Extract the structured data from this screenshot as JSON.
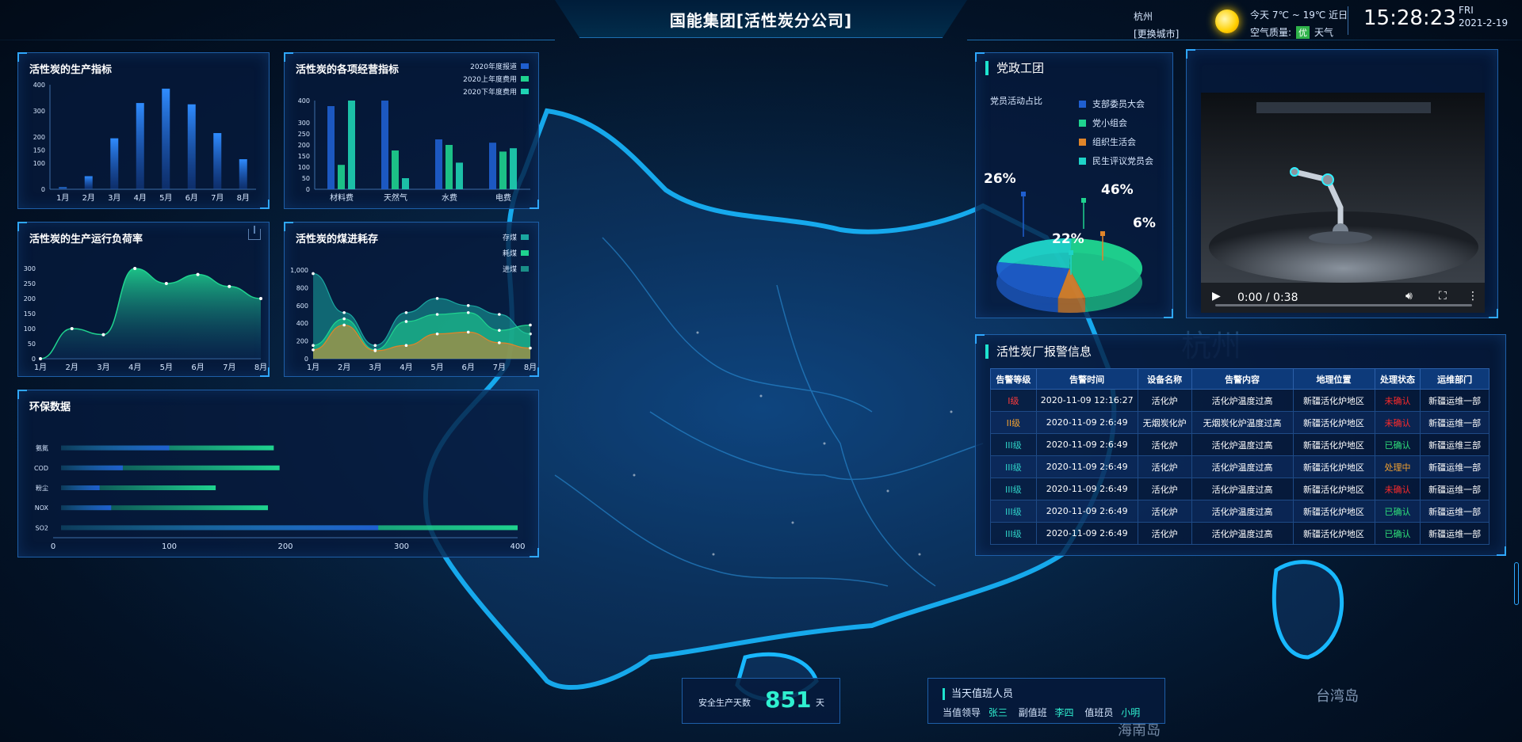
{
  "header": {
    "title": "国能集团[活性炭分公司]",
    "city": "杭州",
    "change_city": "[更换城市]",
    "weather_today": "今天  7℃ ~ 19℃ 近日",
    "air_quality_label": "空气质量:",
    "air_quality_value": "优",
    "weather_link": "天气",
    "time": "15:28:23",
    "weekday": "FRI",
    "date": "2021-2-19",
    "icons": [
      "sun-icon"
    ]
  },
  "panels": {
    "production": {
      "title": "活性炭的生产指标"
    },
    "operation": {
      "title": "活性炭的各项经营指标"
    },
    "load": {
      "title": "活性炭的生产运行负荷率"
    },
    "coal": {
      "title": "活性炭的煤进耗存"
    },
    "env": {
      "title": "环保数据"
    },
    "party": {
      "title": "党政工团",
      "subtitle": "党员活动占比"
    },
    "alarm": {
      "title": "活性炭厂报警信息"
    }
  },
  "chart_data": [
    {
      "type": "bar",
      "title": "活性炭的生产指标",
      "categories": [
        "1月",
        "2月",
        "3月",
        "4月",
        "5月",
        "6月",
        "7月",
        "8月"
      ],
      "values": [
        8,
        50,
        195,
        330,
        385,
        325,
        215,
        115
      ],
      "ylim": [
        0,
        400
      ],
      "yticks": [
        0,
        100,
        150,
        200,
        300,
        400
      ],
      "colors": [
        "#1a4fb4",
        "#2f8cff"
      ]
    },
    {
      "type": "bar",
      "title": "活性炭的各项经营指标",
      "categories": [
        "材料费",
        "天然气",
        "水费",
        "电费"
      ],
      "series": [
        {
          "name": "2020年度报道",
          "values": [
            375,
            400,
            225,
            210
          ],
          "color": "#1f5fd0"
        },
        {
          "name": "2020上年度费用",
          "values": [
            110,
            175,
            200,
            170
          ],
          "color": "#1fd38f"
        },
        {
          "name": "2020下年度费用",
          "values": [
            400,
            50,
            120,
            185
          ],
          "color": "#1fd3b4"
        }
      ],
      "ylim": [
        0,
        400
      ],
      "yticks": [
        0,
        50,
        100,
        150,
        200,
        250,
        300,
        400
      ]
    },
    {
      "type": "area",
      "title": "活性炭的生产运行负荷率",
      "categories": [
        "1月",
        "2月",
        "3月",
        "4月",
        "5月",
        "6月",
        "7月",
        "8月"
      ],
      "values": [
        0,
        100,
        80,
        300,
        250,
        280,
        240,
        200
      ],
      "ylim": [
        0,
        300
      ],
      "yticks": [
        0,
        50,
        100,
        150,
        200,
        250,
        300
      ],
      "color": "#1fd38f"
    },
    {
      "type": "area",
      "title": "活性炭的煤进耗存",
      "categories": [
        "1月",
        "2月",
        "3月",
        "4月",
        "5月",
        "6月",
        "7月",
        "8月"
      ],
      "series": [
        {
          "name": "存煤",
          "values": [
            960,
            520,
            150,
            520,
            680,
            600,
            500,
            280
          ],
          "color": "#1aa6a0"
        },
        {
          "name": "耗煤",
          "values": [
            150,
            450,
            100,
            420,
            500,
            520,
            320,
            380
          ],
          "color": "#1fd38f"
        },
        {
          "name": "进煤",
          "values": [
            100,
            380,
            90,
            150,
            280,
            300,
            180,
            120
          ],
          "color": "#e0852a"
        }
      ],
      "ylim": [
        0,
        1000
      ],
      "yticks": [
        "0",
        "200",
        "400",
        "600",
        "800",
        "1,000"
      ]
    },
    {
      "type": "bar",
      "orientation": "horizontal",
      "title": "环保数据",
      "categories": [
        "氨氮",
        "COD",
        "粉尘",
        "NOX",
        "SO2"
      ],
      "series": [
        {
          "name": "",
          "values": [
            100,
            60,
            40,
            50,
            280
          ],
          "color": "#1f5fd0"
        },
        {
          "name": "",
          "values": [
            190,
            195,
            140,
            185,
            400
          ],
          "color": "#1fd38f"
        }
      ],
      "xlim": [
        0,
        400
      ],
      "xticks": [
        0,
        100,
        200,
        300,
        400
      ]
    },
    {
      "type": "pie",
      "title": "党员活动占比",
      "labels": [
        "支部委员大会",
        "党小组会",
        "组织生活会",
        "民生评议党员会"
      ],
      "values": [
        26,
        46,
        6,
        22
      ],
      "display_labels": [
        "26%",
        "46%",
        "6%",
        "22%"
      ],
      "colors": [
        "#1f5fd0",
        "#1fd38f",
        "#e0852a",
        "#1fd3c8"
      ]
    }
  ],
  "video": {
    "time": "0:00 / 0:38",
    "icons": [
      "play-icon",
      "volume-icon",
      "fullscreen-icon",
      "more-icon"
    ]
  },
  "alarm_table": {
    "headers": [
      "告警等级",
      "告警时间",
      "设备名称",
      "告警内容",
      "地理位置",
      "处理状态",
      "运维部门"
    ],
    "rows": [
      {
        "level": "I级",
        "level_color": "#ff3b3b",
        "time": "2020-11-09 12:16:27",
        "device": "活化炉",
        "content": "活化炉温度过高",
        "location": "新疆活化炉地区",
        "status": "未确认",
        "status_color": "#ff2a2a",
        "dept": "新疆运维一部"
      },
      {
        "level": "II级",
        "level_color": "#f0a030",
        "time": "2020-11-09 2:6:49",
        "device": "无烟炭化炉",
        "content": "无烟炭化炉温度过高",
        "location": "新疆活化炉地区",
        "status": "未确认",
        "status_color": "#ff2a2a",
        "dept": "新疆运维一部"
      },
      {
        "level": "III级",
        "level_color": "#2fd3c8",
        "time": "2020-11-09 2:6:49",
        "device": "活化炉",
        "content": "活化炉温度过高",
        "location": "新疆活化炉地区",
        "status": "已确认",
        "status_color": "#2fe07a",
        "dept": "新疆运维三部"
      },
      {
        "level": "III级",
        "level_color": "#2fd3c8",
        "time": "2020-11-09 2:6:49",
        "device": "活化炉",
        "content": "活化炉温度过高",
        "location": "新疆活化炉地区",
        "status": "处理中",
        "status_color": "#f0a030",
        "dept": "新疆运维一部"
      },
      {
        "level": "III级",
        "level_color": "#2fd3c8",
        "time": "2020-11-09 2:6:49",
        "device": "活化炉",
        "content": "活化炉温度过高",
        "location": "新疆活化炉地区",
        "status": "未确认",
        "status_color": "#ff2a2a",
        "dept": "新疆运维一部"
      },
      {
        "level": "III级",
        "level_color": "#2fd3c8",
        "time": "2020-11-09 2:6:49",
        "device": "活化炉",
        "content": "活化炉温度过高",
        "location": "新疆活化炉地区",
        "status": "已确认",
        "status_color": "#2fe07a",
        "dept": "新疆运维一部"
      },
      {
        "level": "III级",
        "level_color": "#2fd3c8",
        "time": "2020-11-09 2:6:49",
        "device": "活化炉",
        "content": "活化炉温度过高",
        "location": "新疆活化炉地区",
        "status": "已确认",
        "status_color": "#2fe07a",
        "dept": "新疆运维一部"
      }
    ]
  },
  "safety": {
    "label": "安全生产天数",
    "days": "851",
    "unit": "天"
  },
  "duty": {
    "title": "当天值班人员",
    "leader_label": "当值领导",
    "leader": "张三",
    "vice_label": "副值班",
    "vice": "李四",
    "staff_label": "值班员",
    "staff": "小明"
  },
  "map_labels": [
    "杭州",
    "台湾岛",
    "海南岛"
  ],
  "colors": {
    "accent": "#1ee3cf",
    "panel_border": "#1e5fa8",
    "title": "#ffffff"
  }
}
